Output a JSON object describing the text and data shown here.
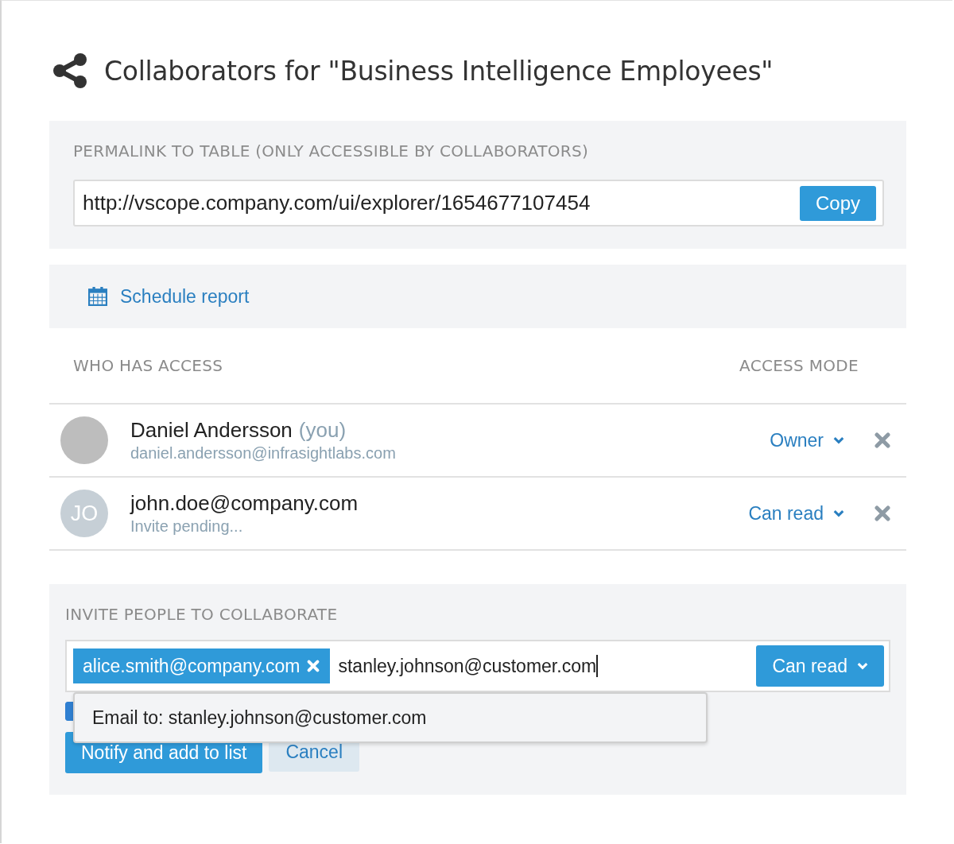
{
  "title": "Collaborators for \"Business Intelligence Employees\"",
  "permalink": {
    "heading": "PERMALINK TO TABLE (ONLY ACCESSIBLE BY COLLABORATORS)",
    "url": "http://vscope.company.com/ui/explorer/1654677107454",
    "button": "Copy"
  },
  "schedule_link": "Schedule report",
  "access": {
    "columns": [
      "WHO HAS ACCESS",
      "ACCESS MODE"
    ],
    "people": [
      {
        "name": "Daniel Andersson",
        "suffix": "(you)",
        "subtitle": "daniel.andersson@infrasightlabs.com",
        "mode": "Owner"
      },
      {
        "initials": "JO",
        "name": "john.doe@company.com",
        "subtitle": "Invite pending...",
        "mode": "Can read"
      }
    ]
  },
  "invite": {
    "heading": "INVITE PEOPLE TO COLLABORATE",
    "tags": [
      "alice.smith@company.com"
    ],
    "value": "stanley.johnson@customer.com",
    "mode": "Can read",
    "suggestion": "Email to: stanley.johnson@customer.com",
    "notify_checkbox": {
      "checked": true
    },
    "primary_button": "Notify and add to list",
    "cancel_button": "Cancel"
  }
}
